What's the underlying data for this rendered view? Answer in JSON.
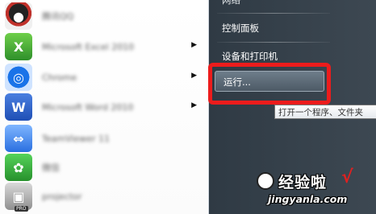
{
  "programs": [
    {
      "icon": "qq-icon",
      "label": "腾讯QQ",
      "has_submenu": false
    },
    {
      "icon": "excel-icon",
      "label": "Microsoft Excel 2010",
      "has_submenu": true
    },
    {
      "icon": "browser-icon",
      "label": "Chrome",
      "has_submenu": true
    },
    {
      "icon": "word-icon",
      "label": "Microsoft Word 2010",
      "has_submenu": true
    },
    {
      "icon": "teamviewer-icon",
      "label": "TeamViewer 11",
      "has_submenu": false
    },
    {
      "icon": "wechat-icon",
      "label": "微信",
      "has_submenu": false
    },
    {
      "icon": "projector-icon",
      "label": "projector",
      "has_submenu": false
    }
  ],
  "pro_tag": "PRO",
  "right_menu": {
    "partial_top": "网络",
    "control_panel": "控制面板",
    "devices_printers": "设备和打印机",
    "run": "运行..."
  },
  "tooltip": "打开一个程序、文件夹",
  "watermark": {
    "title": "经验啦",
    "check": "√",
    "url": "jingyanla.com"
  },
  "colors": {
    "highlight_frame": "#ec1c1c",
    "right_pane": "#35414b"
  }
}
